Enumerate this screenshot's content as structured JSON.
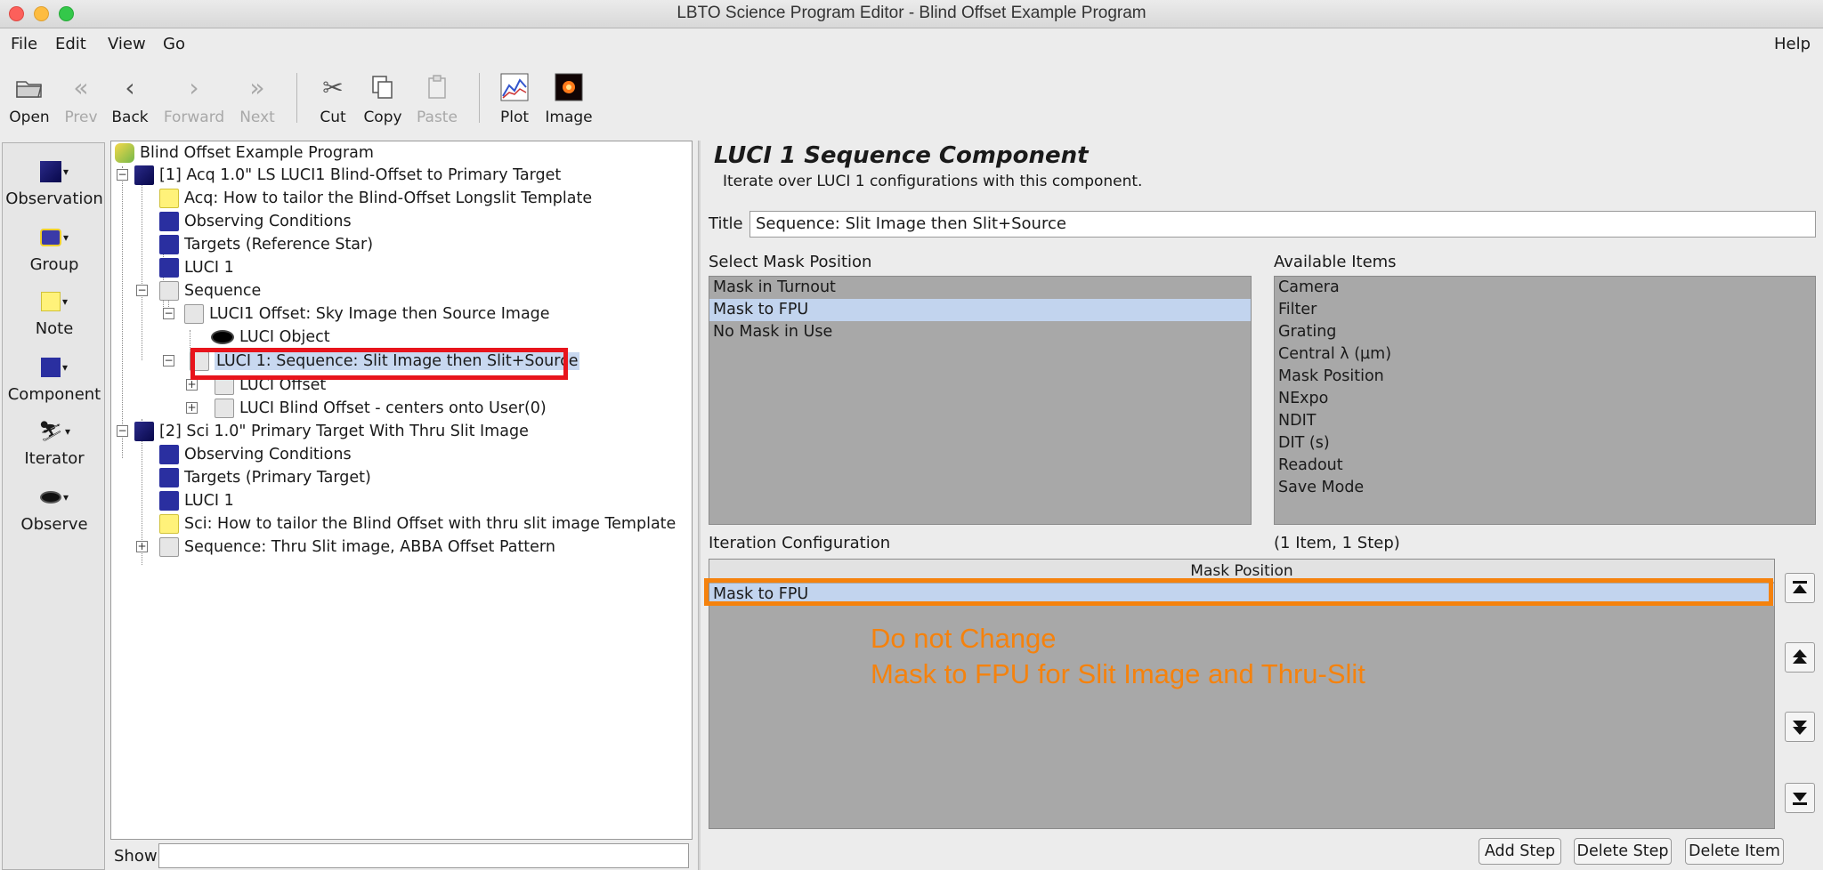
{
  "window": {
    "title": "LBTO Science Program Editor - Blind Offset Example Program"
  },
  "menu": [
    "File",
    "Edit",
    "View",
    "Go"
  ],
  "menu_help": "Help",
  "toolbar": {
    "open": "Open",
    "prev": "Prev",
    "back": "Back",
    "forward": "Forward",
    "next": "Next",
    "cut": "Cut",
    "copy": "Copy",
    "paste": "Paste",
    "plot": "Plot",
    "image": "Image"
  },
  "palette": [
    "Observation",
    "Group",
    "Note",
    "Component",
    "Iterator",
    "Observe"
  ],
  "tree": {
    "items": [
      "Blind Offset Example Program",
      "[1] Acq 1.0\" LS LUCI1 Blind-Offset to Primary Target",
      "Acq: How to tailor the Blind-Offset Longslit Template",
      "Observing Conditions",
      "Targets (Reference Star)",
      "LUCI 1",
      "Sequence",
      "LUCI1 Offset: Sky Image then Source Image",
      "LUCI Object",
      "LUCI 1: Sequence: Slit Image then Slit+Source",
      "LUCI Offset",
      "LUCI Blind Offset - centers onto User(0)",
      "[2] Sci 1.0\" Primary Target With Thru Slit Image",
      "Observing Conditions",
      "Targets (Primary Target)",
      "LUCI 1",
      "Sci: How to tailor the Blind Offset with thru slit image Template",
      "Sequence: Thru Slit image, ABBA Offset Pattern"
    ],
    "show_label": "Show"
  },
  "panel": {
    "heading": "LUCI 1 Sequence Component",
    "description": "Iterate over LUCI 1 configurations with this component.",
    "title_label": "Title",
    "title_value": "Sequence: Slit Image then Slit+Source",
    "mask_label": "Select Mask Position",
    "mask_options": [
      "Mask in Turnout",
      "Mask to FPU",
      "No Mask in Use"
    ],
    "available_label": "Available Items",
    "available_items": [
      "Camera",
      "Filter",
      "Grating",
      "Central λ (µm)",
      "Mask Position",
      "NExpo",
      "NDIT",
      "DIT (s)",
      "Readout",
      "Save Mode"
    ],
    "iteration_label": "Iteration Configuration",
    "iteration_count": "(1 Item, 1 Step)",
    "column_header": "Mask Position",
    "row_value": "Mask to FPU",
    "annotation_line1": "Do not Change",
    "annotation_line2": "Mask to FPU for Slit Image and Thru-Slit",
    "add_step": "Add Step",
    "delete_step": "Delete Step",
    "delete_item": "Delete Item"
  },
  "colors": {
    "highlight_red": "#e8141c",
    "highlight_orange": "#f5820d",
    "selection": "#c2d4ee"
  }
}
